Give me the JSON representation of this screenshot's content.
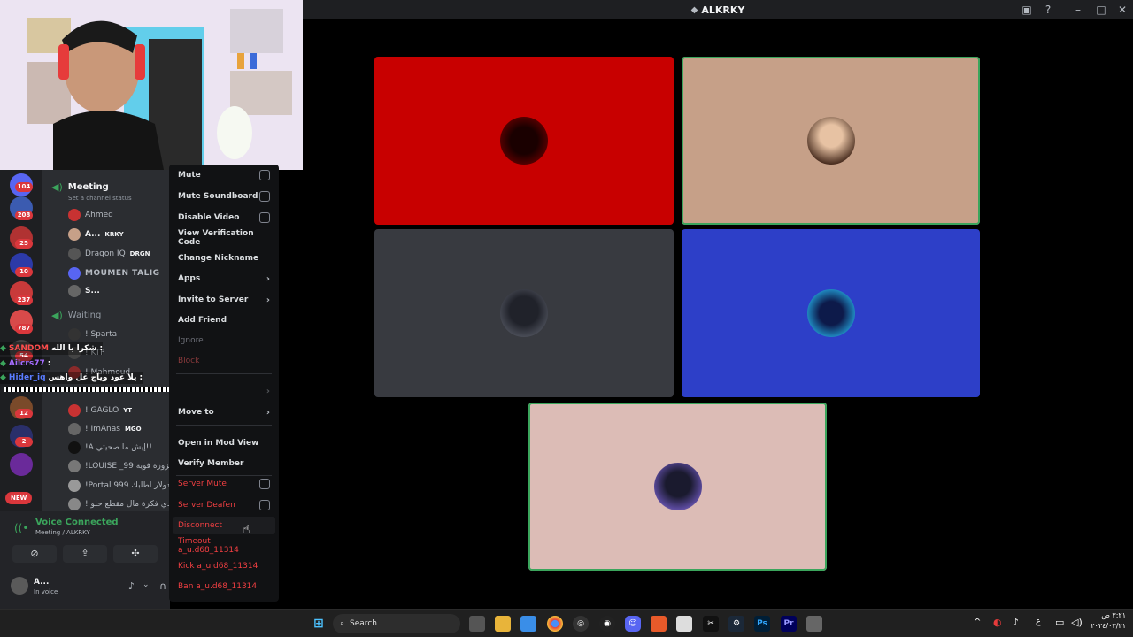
{
  "window": {
    "title": "ALKRKY"
  },
  "colors": {
    "tile_red": "#c80000",
    "tile_tan": "#c6a088",
    "tile_gray": "#383a40",
    "tile_blue": "#2d3fc8",
    "tile_pink": "#dcbcb6",
    "speaking_border": "#3ba55c",
    "danger": "#f23f42"
  },
  "tiles": [
    {
      "name": "tile-red",
      "speaking": false,
      "avatar_icon": "shadow-figure-avatar"
    },
    {
      "name": "tile-tan",
      "speaking": true,
      "avatar_icon": "man-beard-avatar"
    },
    {
      "name": "tile-gray",
      "speaking": false,
      "avatar_icon": "hooded-figure-avatar"
    },
    {
      "name": "tile-blue",
      "speaking": false,
      "avatar_icon": "anime-blue-avatar"
    },
    {
      "name": "tile-pink",
      "speaking": true,
      "avatar_icon": "anime-winged-avatar"
    }
  ],
  "servers": {
    "badges": [
      "104",
      "208",
      "25",
      "10",
      "237",
      "787",
      "54",
      "12",
      "2"
    ],
    "new_label": "NEW"
  },
  "channels": {
    "meeting": {
      "name": "Meeting",
      "status": "Set a channel status"
    },
    "waiting": {
      "name": "Waiting"
    },
    "meeting_members": [
      {
        "name": "Ahmed",
        "tag": ""
      },
      {
        "name": "A...",
        "tag": "KRKY"
      },
      {
        "name": "Dragon IQ",
        "tag": "DRGN"
      },
      {
        "name": "MOUMEN TALIG",
        "tag": ""
      },
      {
        "name": "S...",
        "tag": ""
      }
    ],
    "waiting_members": [
      {
        "name": "! Sparta",
        "tag": ""
      },
      {
        "name": "! KTF",
        "tag": ""
      },
      {
        "name": "! Mahmoud",
        "tag": ""
      },
      {
        "name": "! GAGLO",
        "tag": "YT"
      },
      {
        "name": "! ImAnas",
        "tag": "MGO"
      },
      {
        "name": "!A إيش ما صحيتي!!",
        "tag": ""
      },
      {
        "name": "!LOUISE _99 حزوزة فوية",
        "tag": ""
      },
      {
        "name": "!Portal 999 دولار اطلبك",
        "tag": ""
      },
      {
        "name": "! عندي فكرة مال مقطع حلو",
        "tag": ""
      }
    ]
  },
  "chat": [
    {
      "user": "SANDOM",
      "text": "شكرا يا الله :"
    },
    {
      "user": "Ailcrs77",
      "text": ":"
    },
    {
      "user": "Hider_iq",
      "text": "يلا عود وياج عل واهس :"
    }
  ],
  "voice": {
    "status": "Voice Connected",
    "location": "Meeting / ALKRKY",
    "user_name": "A...",
    "user_status": "In voice"
  },
  "context_menu": [
    {
      "label": "Mute",
      "kind": "check"
    },
    {
      "label": "Mute Soundboard",
      "kind": "check"
    },
    {
      "label": "Disable Video",
      "kind": "check"
    },
    {
      "label": "View Verification Code",
      "kind": "plain"
    },
    {
      "label": "Change Nickname",
      "kind": "plain"
    },
    {
      "label": "Apps",
      "kind": "submenu"
    },
    {
      "label": "Invite to Server",
      "kind": "submenu"
    },
    {
      "label": "Add Friend",
      "kind": "plain"
    },
    {
      "label": "Ignore",
      "kind": "plain"
    },
    {
      "label": "Block",
      "kind": "dim"
    },
    {
      "label": "Move to",
      "kind": "submenu"
    },
    {
      "label": "Open in Mod View",
      "kind": "plain"
    },
    {
      "label": "Verify Member",
      "kind": "plain"
    },
    {
      "label": "Server Mute",
      "kind": "danger-check"
    },
    {
      "label": "Server Deafen",
      "kind": "danger-check"
    },
    {
      "label": "Disconnect",
      "kind": "danger"
    },
    {
      "label": "Timeout a_u.d68_11314",
      "kind": "danger"
    },
    {
      "label": "Kick a_u.d68_11314",
      "kind": "danger"
    },
    {
      "label": "Ban a_u.d68_11314",
      "kind": "danger"
    }
  ],
  "taskbar": {
    "search_placeholder": "Search",
    "time": "٣:٢١ ص",
    "date": "٢٠٢٤/٠٣/٢١",
    "lang": "ع",
    "apps": [
      "windows-start-icon",
      "search-icon",
      "task-view-icon",
      "file-explorer-icon",
      "store-icon",
      "chrome-icon",
      "chatgpt-icon",
      "obs-icon",
      "discord-icon",
      "brave-icon",
      "notepad-icon",
      "capcut-icon",
      "steam-icon",
      "photoshop-icon",
      "premiere-icon",
      "app-icon"
    ]
  }
}
